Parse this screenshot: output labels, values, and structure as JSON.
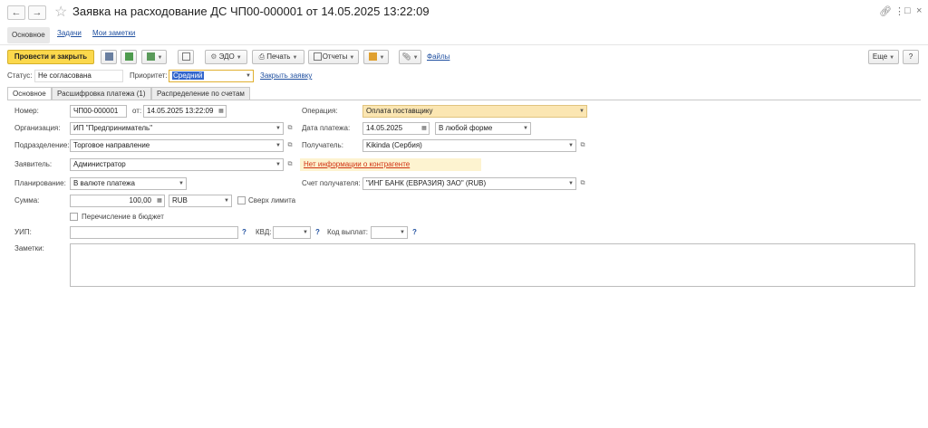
{
  "window": {
    "title": "Заявка на расходование ДС ЧП00-000001 от 14.05.2025 13:22:09",
    "back_icon": "arrow-left-icon",
    "forward_icon": "arrow-right-icon",
    "favorite_icon": "star-icon"
  },
  "nav_tabs": {
    "main": "Основное",
    "tasks": "Задачи",
    "notes": "Мои заметки"
  },
  "toolbar": {
    "post_close": "Провести и закрыть",
    "edo": "ЭДО",
    "print": "Печать",
    "reports": "Отчеты",
    "files": "Файлы",
    "more": "Еще",
    "help": "?"
  },
  "status_row": {
    "status_label": "Статус:",
    "status_value": "Не согласована",
    "priority_label": "Приоритет:",
    "priority_value": "Средний",
    "close_link": "Закрыть заявку"
  },
  "tabs": {
    "main": "Основное",
    "payment_details": "Расшифровка платежа (1)",
    "distribution": "Распределение по счетам"
  },
  "form": {
    "number_label": "Номер:",
    "number_value": "ЧП00-000001",
    "from_label": "от:",
    "date_value": "14.05.2025 13:22:09",
    "org_label": "Организация:",
    "org_value": "ИП \"Предприниматель\"",
    "dept_label": "Подразделение:",
    "dept_value": "Торговое направление",
    "applicant_label": "Заявитель:",
    "applicant_value": "Администратор",
    "planning_label": "Планирование:",
    "planning_value": "В валюте платежа",
    "sum_label": "Сумма:",
    "sum_value": "100,00",
    "currency_value": "RUB",
    "over_limit_label": "Сверх лимита",
    "budget_transfer_label": "Перечисление в бюджет",
    "uip_label": "УИП:",
    "kvd_label": "КВД:",
    "payout_code_label": "Код выплат:",
    "notes_label": "Заметки:",
    "operation_label": "Операция:",
    "operation_value": "Оплата поставщику",
    "pay_date_label": "Дата платежа:",
    "pay_date_value": "14.05.2025",
    "pay_form_value": "В любой форме",
    "recipient_label": "Получатель:",
    "recipient_value": "Kikinda (Сербия)",
    "no_info_warning": "Нет информации о контрагенте",
    "recipient_account_label": "Счет получателя:",
    "recipient_account_value": "\"ИНГ БАНК (ЕВРАЗИЯ) ЗАО\" (RUB)"
  },
  "accent_colors": {
    "primary_button": "#fbd84c",
    "operation_field": "#fbe6b2",
    "link": "#2050a0",
    "warning_text": "#d03010"
  }
}
